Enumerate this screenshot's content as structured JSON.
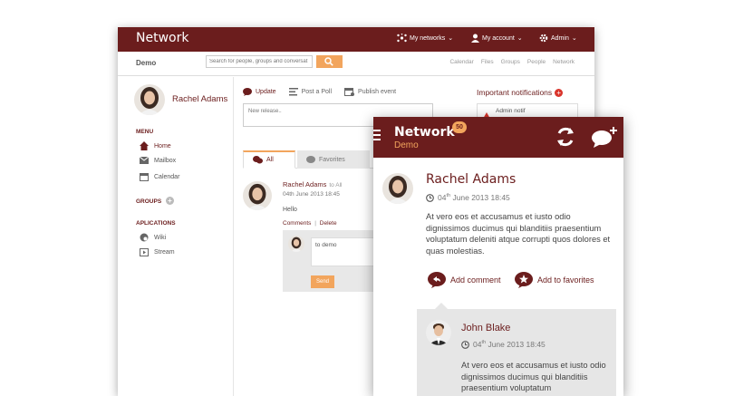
{
  "colors": {
    "brand": "#6b1d1d",
    "accent": "#f2a55d",
    "alert": "#d9342b"
  },
  "desktop": {
    "brand": "Network",
    "top_nav": {
      "my_networks": "My networks",
      "my_account": "My account",
      "admin": "Admin"
    },
    "sub": {
      "demo": "Demo",
      "search_placeholder": "Search for people, groups and conversat",
      "links": [
        "Calendar",
        "Files",
        "Groups",
        "People",
        "Network"
      ]
    },
    "sidebar": {
      "user_name": "Rachel Adams",
      "menu_heading": "MENU",
      "menu_items": [
        "Home",
        "Mailbox",
        "Calendar"
      ],
      "groups_heading": "GROUPS",
      "apps_heading": "APLICATIONS",
      "app_items": [
        "Wiki",
        "Stream"
      ]
    },
    "composer": {
      "tabs": [
        "Update",
        "Post a Poll",
        "Publish event"
      ],
      "placeholder": "New release.."
    },
    "notifications": {
      "title": "Important notifications",
      "item": "Admin notif"
    },
    "feed_tabs": [
      "All",
      "Favorites"
    ],
    "post": {
      "author": "Rachel Adams",
      "to": "to All",
      "date": "04th June 2013 18:45",
      "text": "Hello",
      "comments": "Comments",
      "sep": "|",
      "delete": "Delete",
      "reply_text": "to demo",
      "send": "Send"
    }
  },
  "mobile": {
    "title": "Network",
    "badge": "50",
    "subtitle": "Demo",
    "post": {
      "author": "Rachel Adams",
      "date_day": "04",
      "date_suffix": "th",
      "date_rest": " June 2013 18:45",
      "text": "At vero eos et accusamus et iusto odio dignissimos ducimus qui blanditiis praesentium voluptatum deleniti atque corrupti quos dolores et quas molestias.",
      "add_comment": "Add comment",
      "add_favorites": "Add to favorites"
    },
    "reply": {
      "author": "John Blake",
      "date_day": "04",
      "date_suffix": "th",
      "date_rest": " June 2013 18:45",
      "text": "At vero eos et accusamus et iusto odio dignissimos ducimus qui blanditiis praesentium voluptatum"
    }
  }
}
